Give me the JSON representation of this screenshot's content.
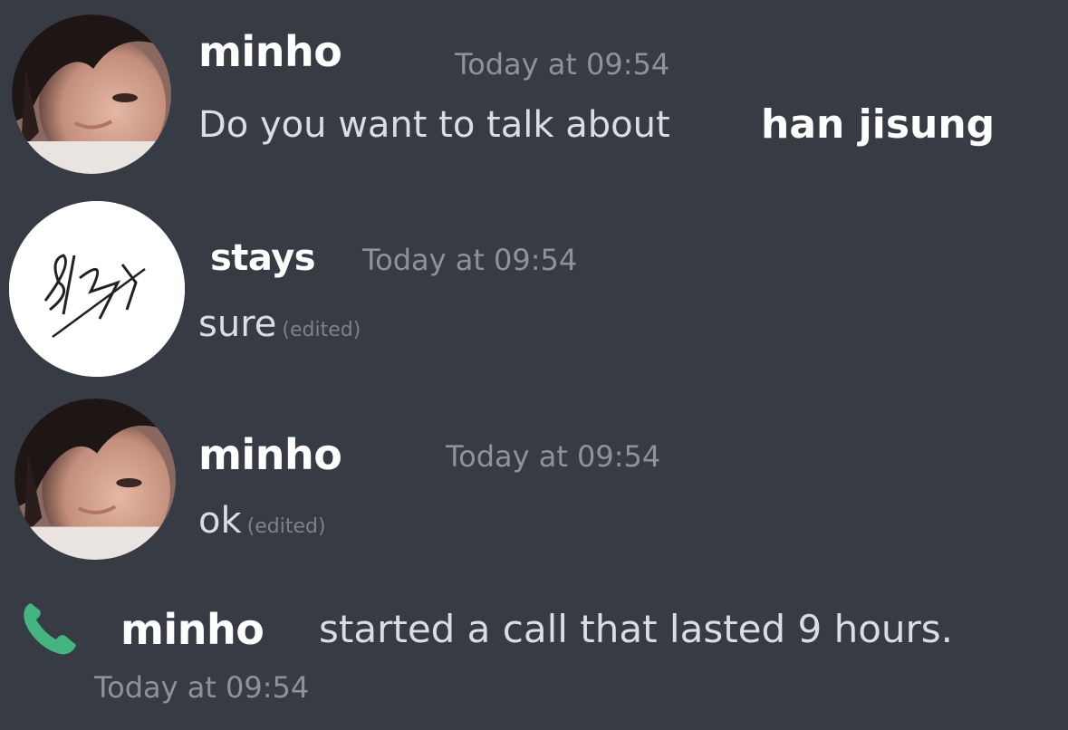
{
  "messages": [
    {
      "username": "minho",
      "timestamp": "Today at 09:54",
      "text": "Do you want to talk about",
      "mention": "han jisung"
    },
    {
      "username": "stays",
      "timestamp": "Today at 09:54",
      "text": "sure",
      "edited": "(edited)"
    },
    {
      "username": "minho",
      "timestamp": "Today at 09:54",
      "text": "ok",
      "edited": "(edited)"
    }
  ],
  "call": {
    "icon": "phone-icon",
    "icon_color": "#43b581",
    "username": "minho",
    "text": "started a call that lasted 9 hours.",
    "timestamp": "Today at 09:54"
  },
  "colors": {
    "background": "#363b44",
    "username": "#ffffff",
    "message": "#dcdde0",
    "timestamp": "#8e939a"
  }
}
